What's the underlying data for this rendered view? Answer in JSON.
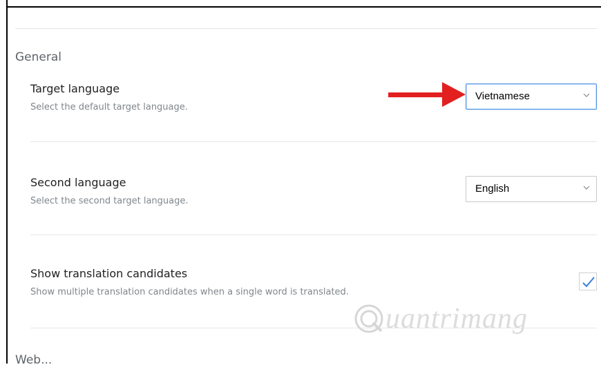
{
  "section": {
    "title": "General",
    "next_title": "Web..."
  },
  "settings": {
    "target_language": {
      "title": "Target language",
      "description": "Select the default target language.",
      "value": "Vietnamese"
    },
    "second_language": {
      "title": "Second language",
      "description": "Select the second target language.",
      "value": "English"
    },
    "translation_candidates": {
      "title": "Show translation candidates",
      "description": "Show multiple translation candidates when a single word is translated.",
      "checked": true
    }
  },
  "watermark": {
    "text": "uantrimang"
  },
  "colors": {
    "arrow": "#e32020",
    "focus_border": "#4a90e2",
    "check": "#3b7ddd"
  }
}
